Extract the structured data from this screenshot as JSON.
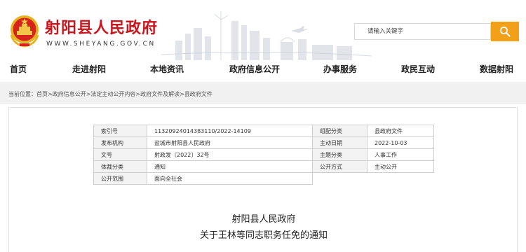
{
  "header": {
    "site_title": "射阳县人民政府",
    "site_url": "WWW.SHEYANG.GOV.CN",
    "search_placeholder": "请输入关键字"
  },
  "nav": {
    "items": [
      "首页",
      "走进射阳",
      "本地资讯",
      "政府信息公开",
      "办事服务",
      "政民互动",
      "数据射阳"
    ]
  },
  "breadcrumb": {
    "prefix": "当前位置：",
    "items": [
      "首页",
      "政府信息公开",
      "法定主动公开内容",
      "政府文件及解读",
      "县政府文件"
    ],
    "separator": ">"
  },
  "info": {
    "index_label": "索引号",
    "index_value": "11320924014383110/2022-14109",
    "category_label": "组配分类",
    "category_value": "县政府文件",
    "publisher_label": "发布机构",
    "publisher_value": "盐城市射阳县人民政府",
    "date_label": "主动日期",
    "date_value": "2022-10-03",
    "docno_label": "文号",
    "docno_value": "射政发〔2022〕32号",
    "topic_label": "主题分类",
    "topic_value": "人事工作",
    "genre_label": "体裁分类",
    "genre_value": "通知",
    "mode_label": "公开方式",
    "mode_value": "主动公开",
    "scope_label": "公开范围",
    "scope_value": "面向全社会"
  },
  "document": {
    "issuer": "射阳县人民政府",
    "title": "关于王林等同志职务任免的通知"
  },
  "colors": {
    "brand_red": "#c8161d",
    "search_orange": "#f2a018"
  }
}
